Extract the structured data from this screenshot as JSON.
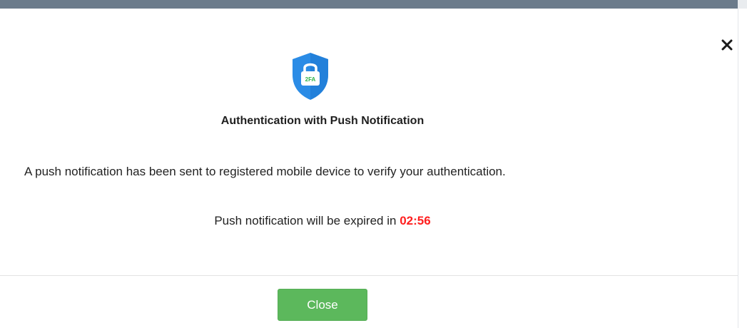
{
  "modal": {
    "title": "Authentication with Push Notification",
    "badge_text": "2FA",
    "badge_icon": "shield-lock-icon",
    "message": "A push notification has been sent to registered mobile device to verify your authentication.",
    "expiry_prefix": "Push notification will be expired in ",
    "countdown": "02:56",
    "close_button_label": "Close",
    "close_icon": "close-icon"
  },
  "colors": {
    "header_bar": "#6b7b8b",
    "shield": "#2b8ce6",
    "countdown": "#ff1f1f",
    "close_button": "#5cb85c"
  }
}
